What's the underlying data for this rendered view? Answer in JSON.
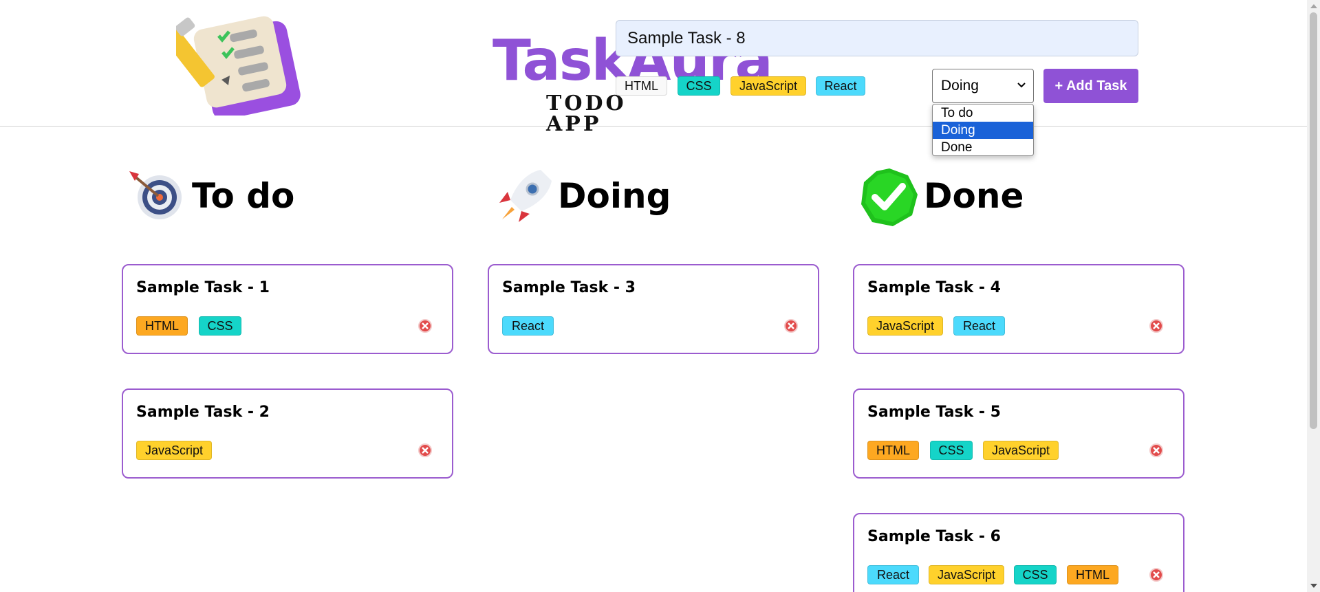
{
  "app": {
    "logo_title": "TaskAura",
    "logo_subtitle": "TODO APP",
    "brand_color": "#8f52d6"
  },
  "form": {
    "task_input_value": "Sample Task - 8",
    "tags": [
      "HTML",
      "CSS",
      "JavaScript",
      "React"
    ],
    "status_selected": "Doing",
    "status_options": [
      "To do",
      "Doing",
      "Done"
    ],
    "add_button_label": "+ Add Task"
  },
  "tag_colors": {
    "HTML": "#fda821",
    "CSS": "#15d4c8",
    "JavaScript": "#ffd12c",
    "React": "#4cdafc"
  },
  "columns": [
    {
      "title": "To do",
      "icon": "target-icon",
      "cards": [
        {
          "title": "Sample Task - 1",
          "tags": [
            "HTML",
            "CSS"
          ]
        },
        {
          "title": "Sample Task - 2",
          "tags": [
            "JavaScript"
          ]
        }
      ]
    },
    {
      "title": "Doing",
      "icon": "rocket-icon",
      "cards": [
        {
          "title": "Sample Task - 3",
          "tags": [
            "React"
          ]
        }
      ]
    },
    {
      "title": "Done",
      "icon": "check-mark-icon",
      "cards": [
        {
          "title": "Sample Task - 4",
          "tags": [
            "JavaScript",
            "React"
          ]
        },
        {
          "title": "Sample Task - 5",
          "tags": [
            "HTML",
            "CSS",
            "JavaScript"
          ]
        },
        {
          "title": "Sample Task - 6",
          "tags": [
            "React",
            "JavaScript",
            "CSS",
            "HTML"
          ]
        }
      ]
    }
  ]
}
